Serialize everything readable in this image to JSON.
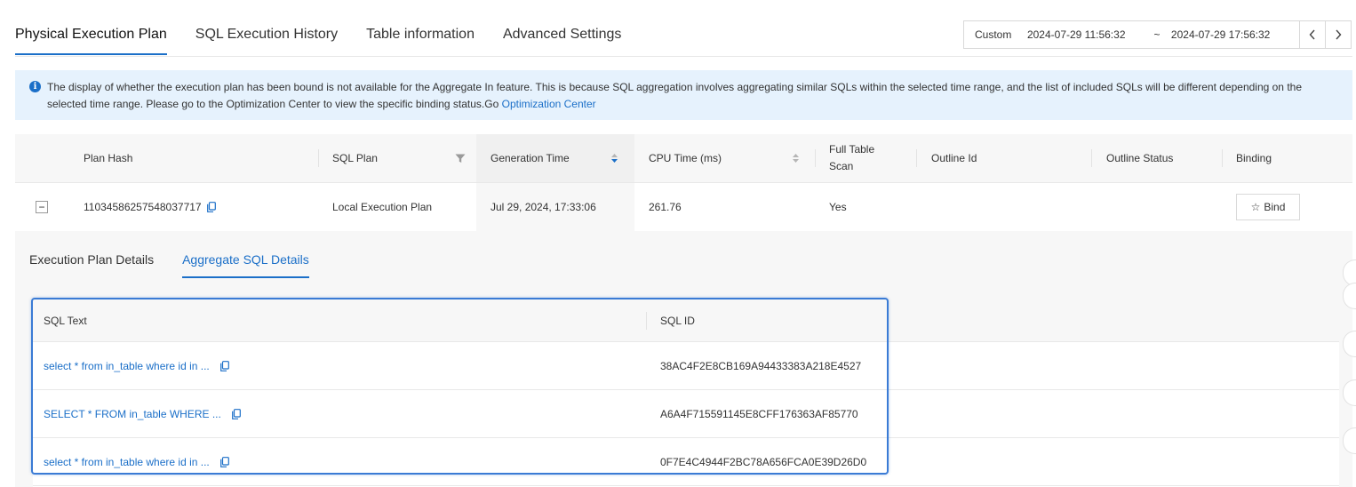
{
  "tabs": [
    {
      "label": "Physical Execution Plan",
      "active": true
    },
    {
      "label": "SQL Execution History",
      "active": false
    },
    {
      "label": "Table information",
      "active": false
    },
    {
      "label": "Advanced Settings",
      "active": false
    }
  ],
  "time_range": {
    "preset": "Custom",
    "start": "2024-07-29 11:56:32",
    "separator": "~",
    "end": "2024-07-29 17:56:32",
    "prev_icon": "chevron-left-icon",
    "next_icon": "chevron-right-icon"
  },
  "notice": {
    "text": "The display of whether the execution plan has been bound is not available for the Aggregate In feature. This is because SQL aggregation involves aggregating similar SQLs within the selected time range, and the list of included SQLs will be different depending on the selected time range. Please go to the Optimization Center to view the specific binding status.Go ",
    "link": "Optimization Center",
    "icon_glyph": "i"
  },
  "plan_table": {
    "headers": {
      "plan_hash": "Plan Hash",
      "sql_plan": "SQL Plan",
      "generation_time": "Generation Time",
      "cpu_time": "CPU Time (ms)",
      "full_table_scan": "Full Table Scan",
      "outline_id": "Outline Id",
      "outline_status": "Outline Status",
      "binding": "Binding"
    },
    "row": {
      "expand_glyph": "−",
      "plan_hash": "11034586257548037717",
      "sql_plan": "Local Execution Plan",
      "generation_time": "Jul 29, 2024, 17:33:06",
      "cpu_time": "261.76",
      "full_table_scan": "Yes",
      "outline_id": "",
      "outline_status": "",
      "bind_label": "Bind"
    }
  },
  "detail_tabs": [
    {
      "label": "Execution Plan Details",
      "active": false
    },
    {
      "label": "Aggregate SQL Details",
      "active": true
    }
  ],
  "aggregate_table": {
    "headers": {
      "sql_text": "SQL Text",
      "sql_id": "SQL ID"
    },
    "rows": [
      {
        "sql_text": "select * from in_table where id in ...",
        "sql_id": "38AC4F2E8CB169A94433383A218E4527"
      },
      {
        "sql_text": "SELECT * FROM in_table WHERE ...",
        "sql_id": "A6A4F715591145E8CFF176363AF85770"
      },
      {
        "sql_text": "select * from in_table where id in ...",
        "sql_id": "0F7E4C4944F2BC78A656FCA0E39D26D0"
      }
    ]
  },
  "colors": {
    "accent": "#1b6fc8",
    "notice_bg": "#e6f2fd",
    "highlight": "#3a7bd5"
  }
}
